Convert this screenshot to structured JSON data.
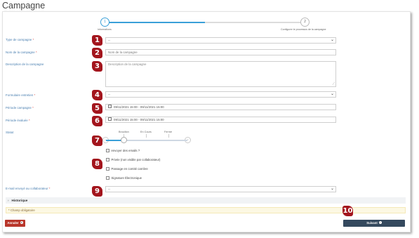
{
  "page": {
    "title": "Campagne"
  },
  "stepper": {
    "steps": [
      {
        "number": "1",
        "label": "Informations"
      },
      {
        "number": "2",
        "label": "Configurer le processus de la campagne"
      }
    ]
  },
  "form": {
    "type_campagne": {
      "label": "Type de campagne",
      "required": "*",
      "value": "--"
    },
    "nom_campagne": {
      "label": "Nom de la campagne",
      "required": "*",
      "placeholder": "Nom de la campagne"
    },
    "description": {
      "label": "Description de la campagne",
      "placeholder": "Description de la campagne"
    },
    "formulaire_entretien": {
      "label": "Formulaire entretien",
      "required": "*",
      "value": "--"
    },
    "periode_campagne": {
      "label": "Période campagne",
      "required": "*",
      "value": "09/11/2021 15:00 - 09/11/2021 15:00"
    },
    "periode_evaluee": {
      "label": "Période évaluée",
      "required": "*",
      "value": "09/11/2021 15:00 - 09/11/2021 15:00"
    },
    "statut": {
      "label": "Statut",
      "levels": [
        "Brouillon",
        "En Cours",
        "Fermé"
      ],
      "selected_index": 0
    },
    "options": [
      {
        "label": "envoyer des emails ?",
        "checked": false
      },
      {
        "label": "Privée (non visible par collaborateur)",
        "checked": false
      },
      {
        "label": "Passage en comité carrière",
        "checked": false
      },
      {
        "label": "Signature Électronique",
        "checked": false
      }
    ],
    "email_envoye": {
      "label": "E-mail envoyé au collaborateur",
      "required": "*",
      "value": "--"
    }
  },
  "markers": [
    "1",
    "2",
    "3",
    "4",
    "5",
    "6",
    "7",
    "8",
    "9",
    "10"
  ],
  "historique": {
    "label": "Historique"
  },
  "required_note": "* Champ obligatoire",
  "buttons": {
    "cancel": "Annuler",
    "next": "Suivant"
  },
  "colors": {
    "accent": "#3aa0d8",
    "marker": "#a3151d",
    "cancel": "#b9362b",
    "next": "#34495e",
    "label": "#4a7fb0"
  }
}
